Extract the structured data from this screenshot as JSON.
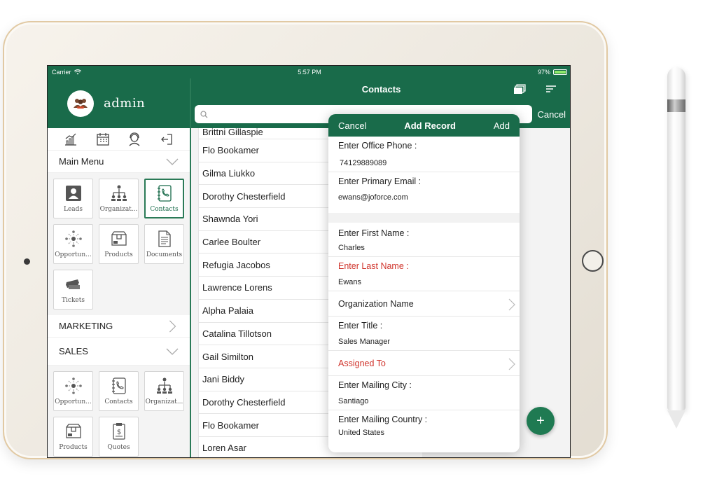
{
  "status_bar": {
    "carrier": "Carrier",
    "time": "5:57 PM",
    "battery": "97%",
    "battery_level": 0.97
  },
  "sidebar": {
    "user_name": "admin",
    "quick_icons": [
      "chart-icon",
      "calendar-icon",
      "support-icon",
      "logout-icon"
    ],
    "main_menu_label": "Main Menu",
    "main_menu_tiles": [
      {
        "label": "Leads",
        "icon": "lead-icon",
        "active": false
      },
      {
        "label": "Organizat...",
        "icon": "org-chart-icon",
        "active": false
      },
      {
        "label": "Contacts",
        "icon": "contacts-icon",
        "active": true
      },
      {
        "label": "Opportun...",
        "icon": "opportunity-icon",
        "active": false
      },
      {
        "label": "Products",
        "icon": "products-icon",
        "active": false
      },
      {
        "label": "Documents",
        "icon": "documents-icon",
        "active": false
      },
      {
        "label": "Tickets",
        "icon": "tickets-icon",
        "active": false
      }
    ],
    "marketing_label": "MARKETING",
    "sales_label": "SALES",
    "sales_tiles": [
      {
        "label": "Opportun...",
        "icon": "opportunity-icon"
      },
      {
        "label": "Contacts",
        "icon": "contacts-icon"
      },
      {
        "label": "Organizat...",
        "icon": "org-chart-icon"
      },
      {
        "label": "Products",
        "icon": "products-icon"
      },
      {
        "label": "Quotes",
        "icon": "quotes-icon"
      }
    ]
  },
  "header": {
    "title": "Contacts",
    "search_cancel": "Cancel",
    "search_placeholder": ""
  },
  "contacts": [
    "Brittni Gillaspie",
    "Flo Bookamer",
    "Gilma Liukko",
    "Dorothy Chesterfield",
    "Shawnda Yori",
    "Carlee Boulter",
    "Refugia Jacobos",
    "Lawrence Lorens",
    "Alpha Palaia",
    "Catalina Tillotson",
    "Gail Similton",
    "Jani Biddy",
    "Dorothy Chesterfield",
    "Flo Bookamer",
    "Loren Asar"
  ],
  "modal": {
    "cancel": "Cancel",
    "title": "Add Record",
    "add": "Add",
    "office_phone_label": "Enter Office Phone :",
    "office_phone_value": "74129889089",
    "primary_email_label": "Enter Primary Email :",
    "primary_email_value": "ewans@joforce.com",
    "first_name_label": "Enter First Name :",
    "first_name_value": "Charles",
    "last_name_label": "Enter Last Name :",
    "last_name_value": "Ewans",
    "org_name_label": "Organization Name",
    "title_label": "Enter Title :",
    "title_value": "Sales Manager",
    "assigned_to_label": "Assigned To",
    "city_label": "Enter Mailing City :",
    "city_value": "Santiago",
    "country_label": "Enter Mailing Country :",
    "country_value": "United States"
  },
  "fab_label": "+",
  "colors": {
    "brand": "#196b4a",
    "required": "#d0342c"
  }
}
